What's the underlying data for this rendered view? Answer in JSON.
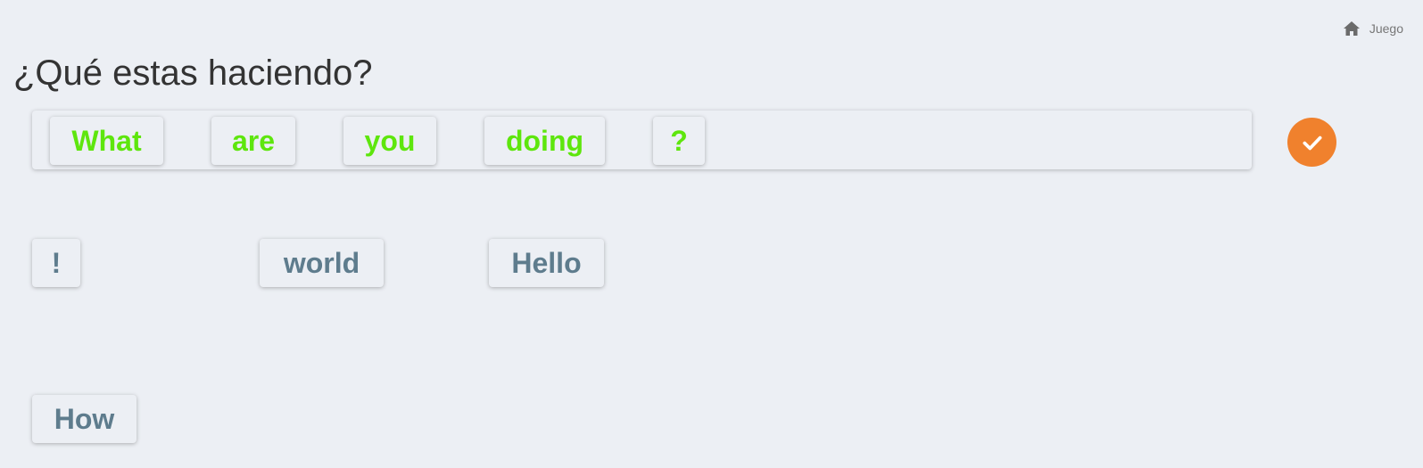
{
  "breadcrumb": {
    "icon": "home-icon",
    "label": "Juego"
  },
  "question": {
    "prompt": "¿Qué estas haciendo?"
  },
  "answer": {
    "placed_words": [
      "What",
      "are",
      "you",
      "doing",
      "?"
    ],
    "placed_color": "#5ee60d"
  },
  "word_bank": {
    "words": [
      "!",
      "world",
      "Hello",
      "How"
    ],
    "word_color": "#5e7c8d"
  },
  "check_button": {
    "icon": "checkmark-icon",
    "color": "#f0812d"
  },
  "background_color": "#eceff4"
}
